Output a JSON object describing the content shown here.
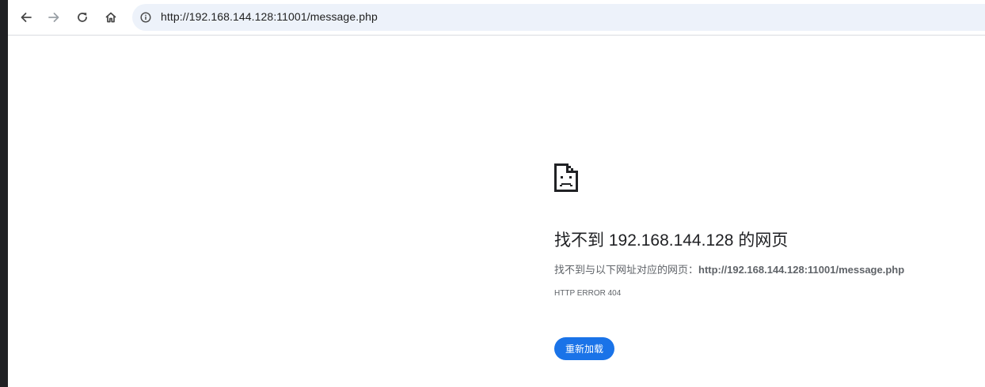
{
  "browser": {
    "address_bar": {
      "url": "http://192.168.144.128:11001/message.php"
    },
    "icons": {
      "back": "back-arrow-icon",
      "forward": "forward-arrow-icon",
      "reload": "reload-icon",
      "home": "home-icon",
      "site_info": "info-icon"
    }
  },
  "error_page": {
    "icon": "sad-page-icon",
    "title": "找不到 192.168.144.128 的网页",
    "description_prefix": "找不到与以下网址对应的网页：",
    "description_url": "http://192.168.144.128:11001/message.php",
    "error_code": "HTTP ERROR 404",
    "reload_label": "重新加载"
  },
  "colors": {
    "omnibox_bg": "#edf2fa",
    "button_blue": "#1a73e8",
    "text_primary": "#202124",
    "text_secondary": "#5f6368",
    "forward_disabled": "#9aa0a6"
  }
}
